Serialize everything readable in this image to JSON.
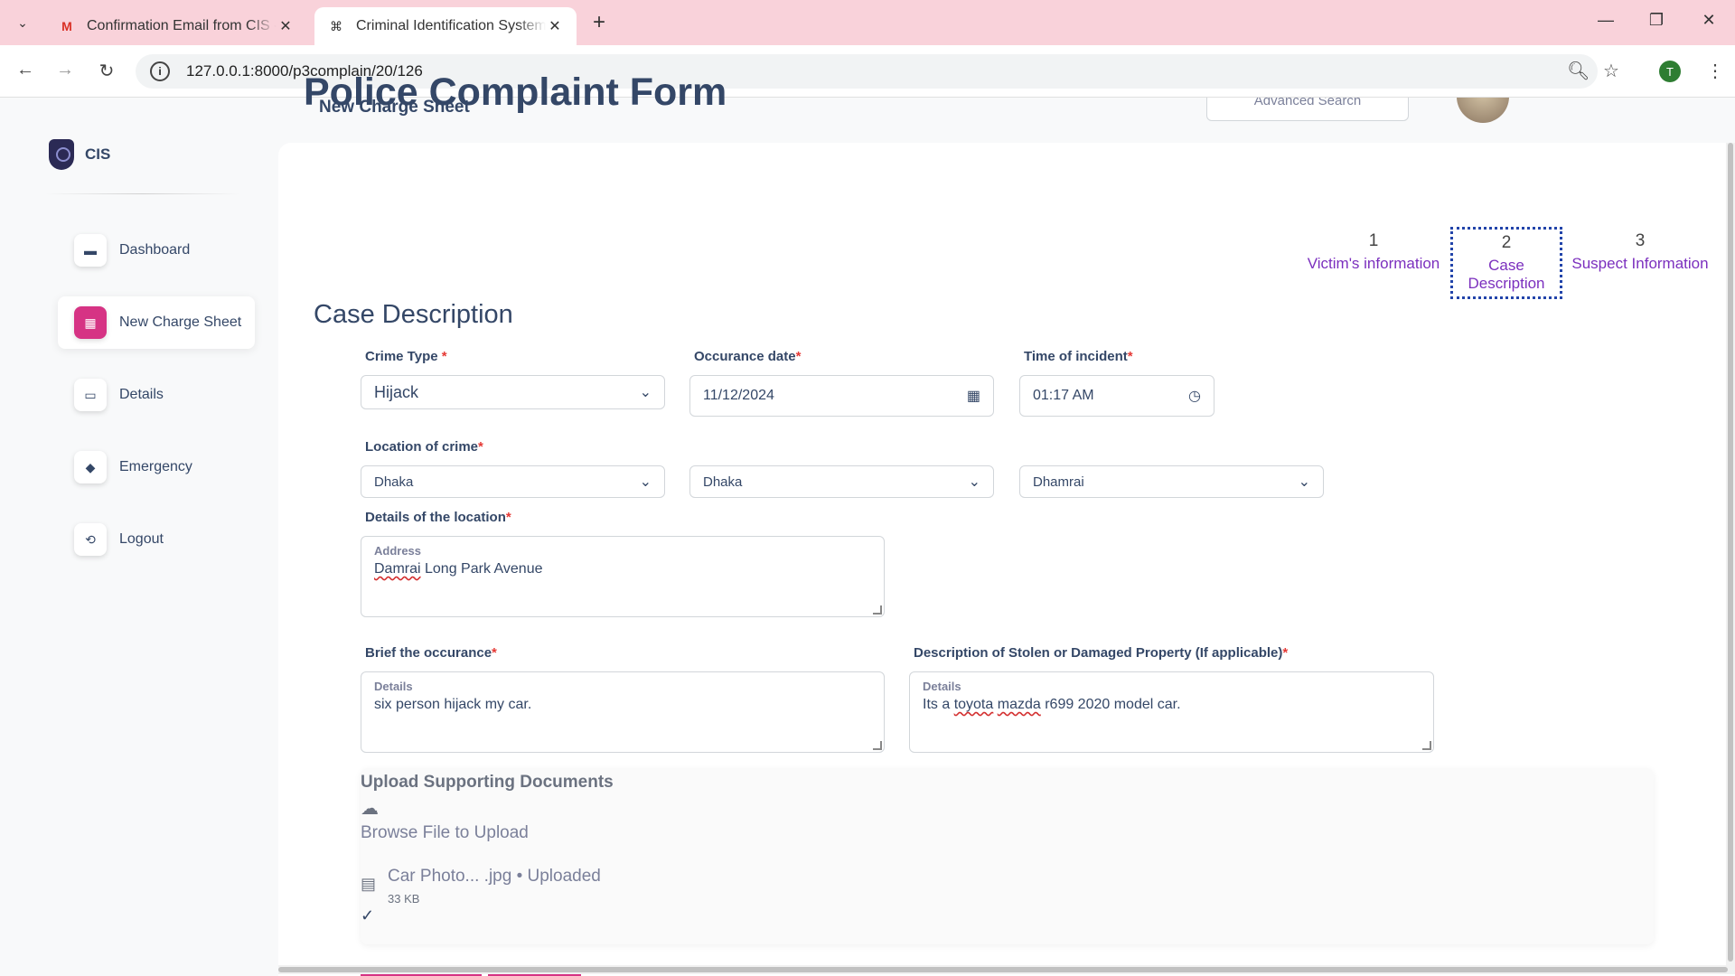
{
  "browser": {
    "tabs": [
      {
        "title": "Confirmation Email from CIS - t",
        "favicon": "gmail-icon",
        "active": false
      },
      {
        "title": "Criminal Identification System -",
        "favicon": "site-icon",
        "active": true
      }
    ],
    "url": "127.0.0.1:8000/p3complain/20/126",
    "profile_initial": "T"
  },
  "header": {
    "page_title": "New Charge Sheet",
    "advanced_search": "Advanced Search"
  },
  "sidebar": {
    "logo_text": "CIS",
    "items": [
      {
        "label": "Dashboard",
        "icon": "shop-icon"
      },
      {
        "label": "New Charge Sheet",
        "icon": "office-icon"
      },
      {
        "label": "Details",
        "icon": "credit-card-icon"
      },
      {
        "label": "Emergency",
        "icon": "box-icon"
      },
      {
        "label": "Logout",
        "icon": "logout-icon"
      }
    ]
  },
  "form": {
    "title": "Police Complaint Form",
    "steps": [
      {
        "num": "1",
        "label": "Victim's information"
      },
      {
        "num": "2",
        "label": "Case Description"
      },
      {
        "num": "3",
        "label": "Suspect Information"
      }
    ],
    "section_title": "Case Description",
    "crime_type": {
      "label": "Crime Type",
      "required": "*",
      "value": "Hijack"
    },
    "occurance_date": {
      "label": "Occurance date",
      "required": "*",
      "value": "11/12/2024"
    },
    "time_of_incident": {
      "label": "Time of incident",
      "required": "*",
      "value": "01:17 AM"
    },
    "location": {
      "label": "Location of crime",
      "required": "*",
      "division": "Dhaka",
      "district": "Dhaka",
      "upazila": "Dhamrai"
    },
    "location_details": {
      "label": "Details of the location",
      "required": "*",
      "field_label": "Address",
      "value_first": "Damrai",
      "value_rest": " Long Park Avenue"
    },
    "brief": {
      "label": "Brief the occurance",
      "required": "*",
      "field_label": "Details",
      "value": "six person hijack my car."
    },
    "property": {
      "label": "Description of Stolen or Damaged Property (If applicable)",
      "required": "*",
      "field_label": "Details",
      "value_a": "Its a ",
      "value_b": "toyota",
      "value_c": " ",
      "value_d": "mazda",
      "value_e": " r699 2020 model car."
    },
    "upload": {
      "title": "Upload Supporting Documents",
      "browse": "Browse File to Upload",
      "file_name": "Car Photo... .jpg • Uploaded",
      "file_size": "33 KB"
    }
  },
  "colors": {
    "accent": "#d63384",
    "step_link": "#7b2fbe",
    "required": "#e53935",
    "tabbar": "#f9d2da"
  }
}
